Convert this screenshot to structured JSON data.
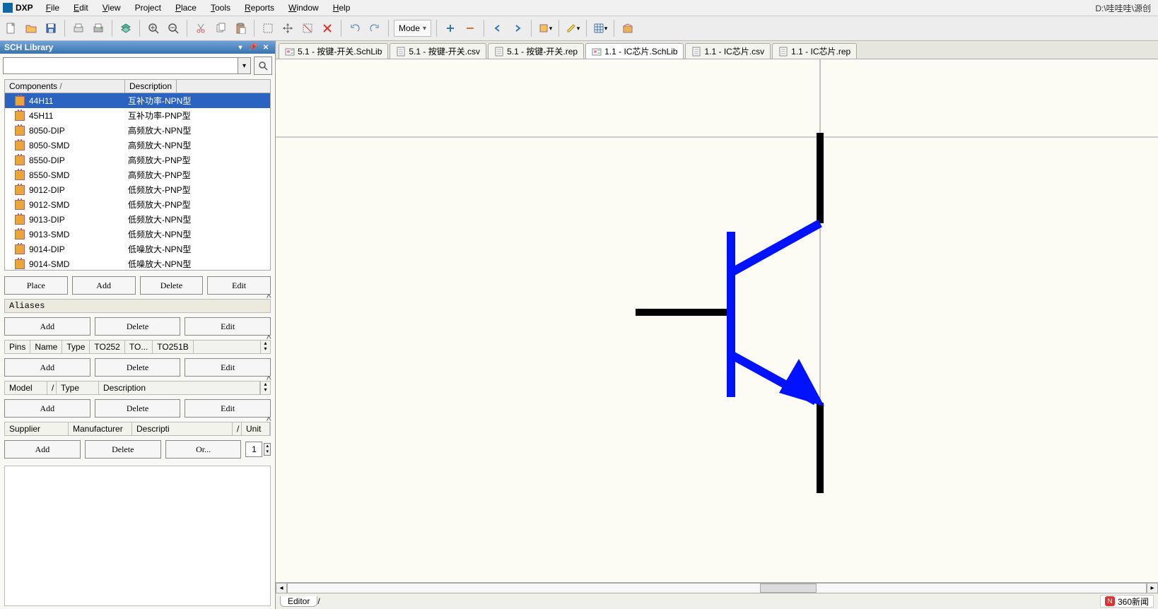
{
  "path_label": "D:\\哇哇哇\\源创",
  "menu": {
    "dxp": "DXP",
    "file": "File",
    "edit": "Edit",
    "view": "View",
    "project": "Project",
    "place": "Place",
    "tools": "Tools",
    "reports": "Reports",
    "window": "Window",
    "help": "Help"
  },
  "toolbar": {
    "mode": "Mode"
  },
  "panel": {
    "title": "SCH Library",
    "headers": {
      "components": "Components",
      "description": "Description"
    },
    "components": [
      {
        "name": "44H11",
        "desc": "互补功率-NPN型"
      },
      {
        "name": "45H11",
        "desc": "互补功率-PNP型"
      },
      {
        "name": "8050-DIP",
        "desc": "高频放大-NPN型"
      },
      {
        "name": "8050-SMD",
        "desc": "高频放大-NPN型"
      },
      {
        "name": "8550-DIP",
        "desc": "高频放大-PNP型"
      },
      {
        "name": "8550-SMD",
        "desc": "高频放大-PNP型"
      },
      {
        "name": "9012-DIP",
        "desc": "低频放大-PNP型"
      },
      {
        "name": "9012-SMD",
        "desc": "低频放大-PNP型"
      },
      {
        "name": "9013-DIP",
        "desc": "低频放大-NPN型"
      },
      {
        "name": "9013-SMD",
        "desc": "低频放大-NPN型"
      },
      {
        "name": "9014-DIP",
        "desc": "低噪放大-NPN型"
      },
      {
        "name": "9014-SMD",
        "desc": "低噪放大-NPN型"
      }
    ],
    "buttons": {
      "place": "Place",
      "add": "Add",
      "delete": "Delete",
      "edit": "Edit",
      "order": "Or...",
      "order_val": "1"
    },
    "aliases": "Aliases",
    "pins": {
      "pins": "Pins",
      "name": "Name",
      "type": "Type",
      "p1": "TO252",
      "p2": "TO...",
      "p3": "TO251B"
    },
    "model": {
      "model": "Model",
      "type": "Type",
      "description": "Description"
    },
    "supplier": {
      "supplier": "Supplier",
      "manufacturer": "Manufacturer",
      "description": "Descripti",
      "unit": "Unit"
    }
  },
  "tabs": [
    {
      "label": "5.1  - 按键-开关.SchLib",
      "type": "sch"
    },
    {
      "label": "5.1  - 按键-开关.csv",
      "type": "txt"
    },
    {
      "label": "5.1  - 按键-开关.rep",
      "type": "txt"
    },
    {
      "label": "1.1  - IC芯片.SchLib",
      "type": "sch",
      "active": true
    },
    {
      "label": "1.1  - IC芯片.csv",
      "type": "txt"
    },
    {
      "label": "1.1  - IC芯片.rep",
      "type": "txt"
    }
  ],
  "editor_tab": "Editor",
  "news": "360新闻"
}
